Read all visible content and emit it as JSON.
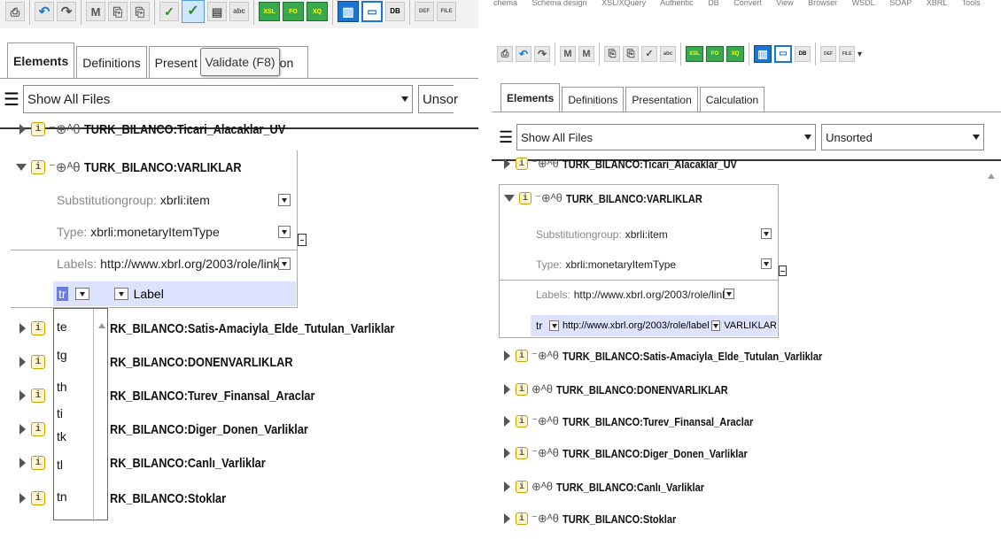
{
  "left": {
    "toolbar_glyphs": [
      "⎙",
      "↶",
      "↷",
      "M",
      "⎘",
      "⎘",
      "✓",
      "✓",
      "▤",
      "abc",
      "XSL",
      "FO",
      "XQ",
      "▥",
      "▭",
      "DB",
      "DEF",
      "FILE"
    ],
    "tabs": [
      "Elements",
      "Definitions",
      "Present",
      "ation"
    ],
    "tooltip": "Validate (F8)",
    "file_filter": "Show All Files",
    "sort_filter": "Unsor",
    "elements": {
      "prev": "TURK_BILANCO:Ticari_Alacaklar_UV",
      "expanded": "TURK_BILANCO:VARLIKLAR",
      "rows": [
        "RK_BILANCO:Satis-Amaciyla_Elde_Tutulan_Varliklar",
        "RK_BILANCO:DONENVARLIKLAR",
        "RK_BILANCO:Turev_Finansal_Araclar",
        "RK_BILANCO:Diger_Donen_Varliklar",
        "RK_BILANCO:Canlı_Varliklar",
        "RK_BILANCO:Stoklar"
      ]
    },
    "detail": {
      "subst_key": "Substitutiongroup:",
      "subst_val": "xbrli:item",
      "type_key": "Type:",
      "type_val": "xbrli:monetaryItemType",
      "labels_key": "Labels:",
      "labels_val": "http://www.xbrl.org/2003/role/link",
      "lang": "tr",
      "label_col": "Label"
    },
    "lang_dropdown": [
      "te",
      "tg",
      "th",
      "ti",
      "tk",
      "tl",
      "tn"
    ]
  },
  "right": {
    "menu": [
      "chema",
      "Schema design",
      "XSL/XQuery",
      "Authentic",
      "DB",
      "Convert",
      "View",
      "Browser",
      "WSDL",
      "SOAP",
      "XBRL",
      "Tools"
    ],
    "toolbar_glyphs": [
      "⎙",
      "↶",
      "↷",
      "M",
      "M",
      "⎘",
      "⎘",
      "✓",
      "abc",
      "XSL",
      "FO",
      "XQ",
      "▥",
      "▭",
      "DB",
      "DEF",
      "FILE"
    ],
    "tabs": [
      "Elements",
      "Definitions",
      "Presentation",
      "Calculation"
    ],
    "file_filter": "Show All Files",
    "sort_filter": "Unsorted",
    "elements": {
      "prev": "TURK_BILANCO:Ticari_Alacaklar_UV",
      "expanded": "TURK_BILANCO:VARLIKLAR",
      "rows": [
        "TURK_BILANCO:Satis-Amaciyla_Elde_Tutulan_Varliklar",
        "TURK_BILANCO:DONENVARLIKLAR",
        "TURK_BILANCO:Turev_Finansal_Araclar",
        "TURK_BILANCO:Diger_Donen_Varliklar",
        "TURK_BILANCO:Canlı_Varliklar",
        "TURK_BILANCO:Stoklar"
      ]
    },
    "detail": {
      "subst_key": "Substitutiongroup:",
      "subst_val": "xbrli:item",
      "type_key": "Type:",
      "type_val": "xbrli:monetaryItemType",
      "labels_key": "Labels:",
      "labels_val": "http://www.xbrl.org/2003/role/link",
      "lang": "tr",
      "role": "http://www.xbrl.org/2003/role/label",
      "label_text": "VARLIKLAR"
    }
  },
  "marks": {
    "dash_circle": "⁻⊕ᴬθ",
    "circle": "⊕ᴬθ"
  },
  "colors": {
    "green_btn": "#3aa84c",
    "blue_btn": "#1a76d2",
    "label_row": "#dde3ff",
    "info_icon": "#c8a000"
  }
}
